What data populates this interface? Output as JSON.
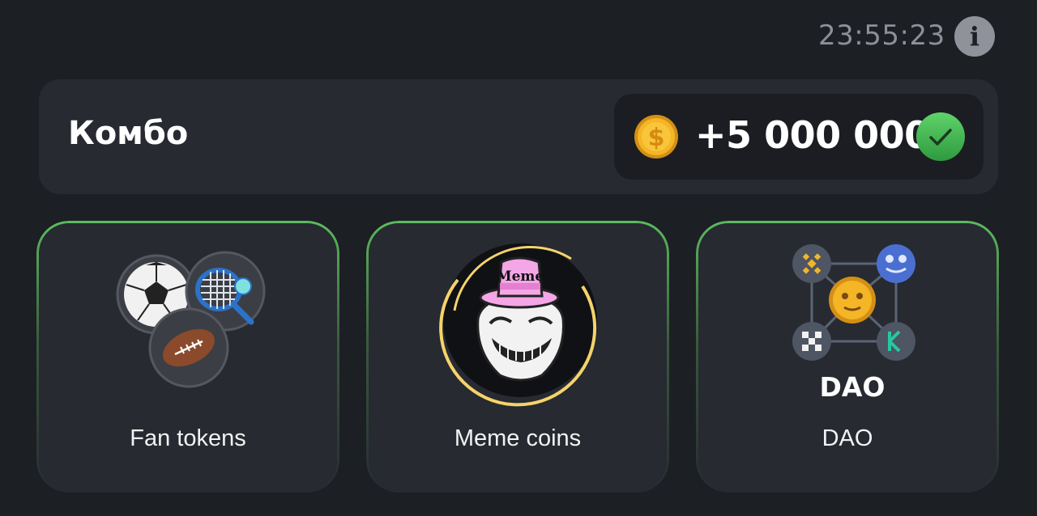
{
  "header": {
    "timer": "23:55:23",
    "info_icon": "info-icon"
  },
  "combo": {
    "title": "Комбо",
    "reward": "+5 000 000",
    "coin_icon": "coin-icon",
    "status_icon": "check-icon"
  },
  "cards": [
    {
      "label": "Fan tokens",
      "icon": "sports-balls-icon"
    },
    {
      "label": "Meme coins",
      "icon": "meme-troll-icon",
      "hat_text": "Meme"
    },
    {
      "label": "DAO",
      "icon": "dao-network-icon",
      "logo_text": "DAO"
    }
  ],
  "colors": {
    "background": "#1c1f24",
    "panel": "#272a31",
    "accent_green": "#5cbb5e",
    "gold": "#f0b62c"
  }
}
